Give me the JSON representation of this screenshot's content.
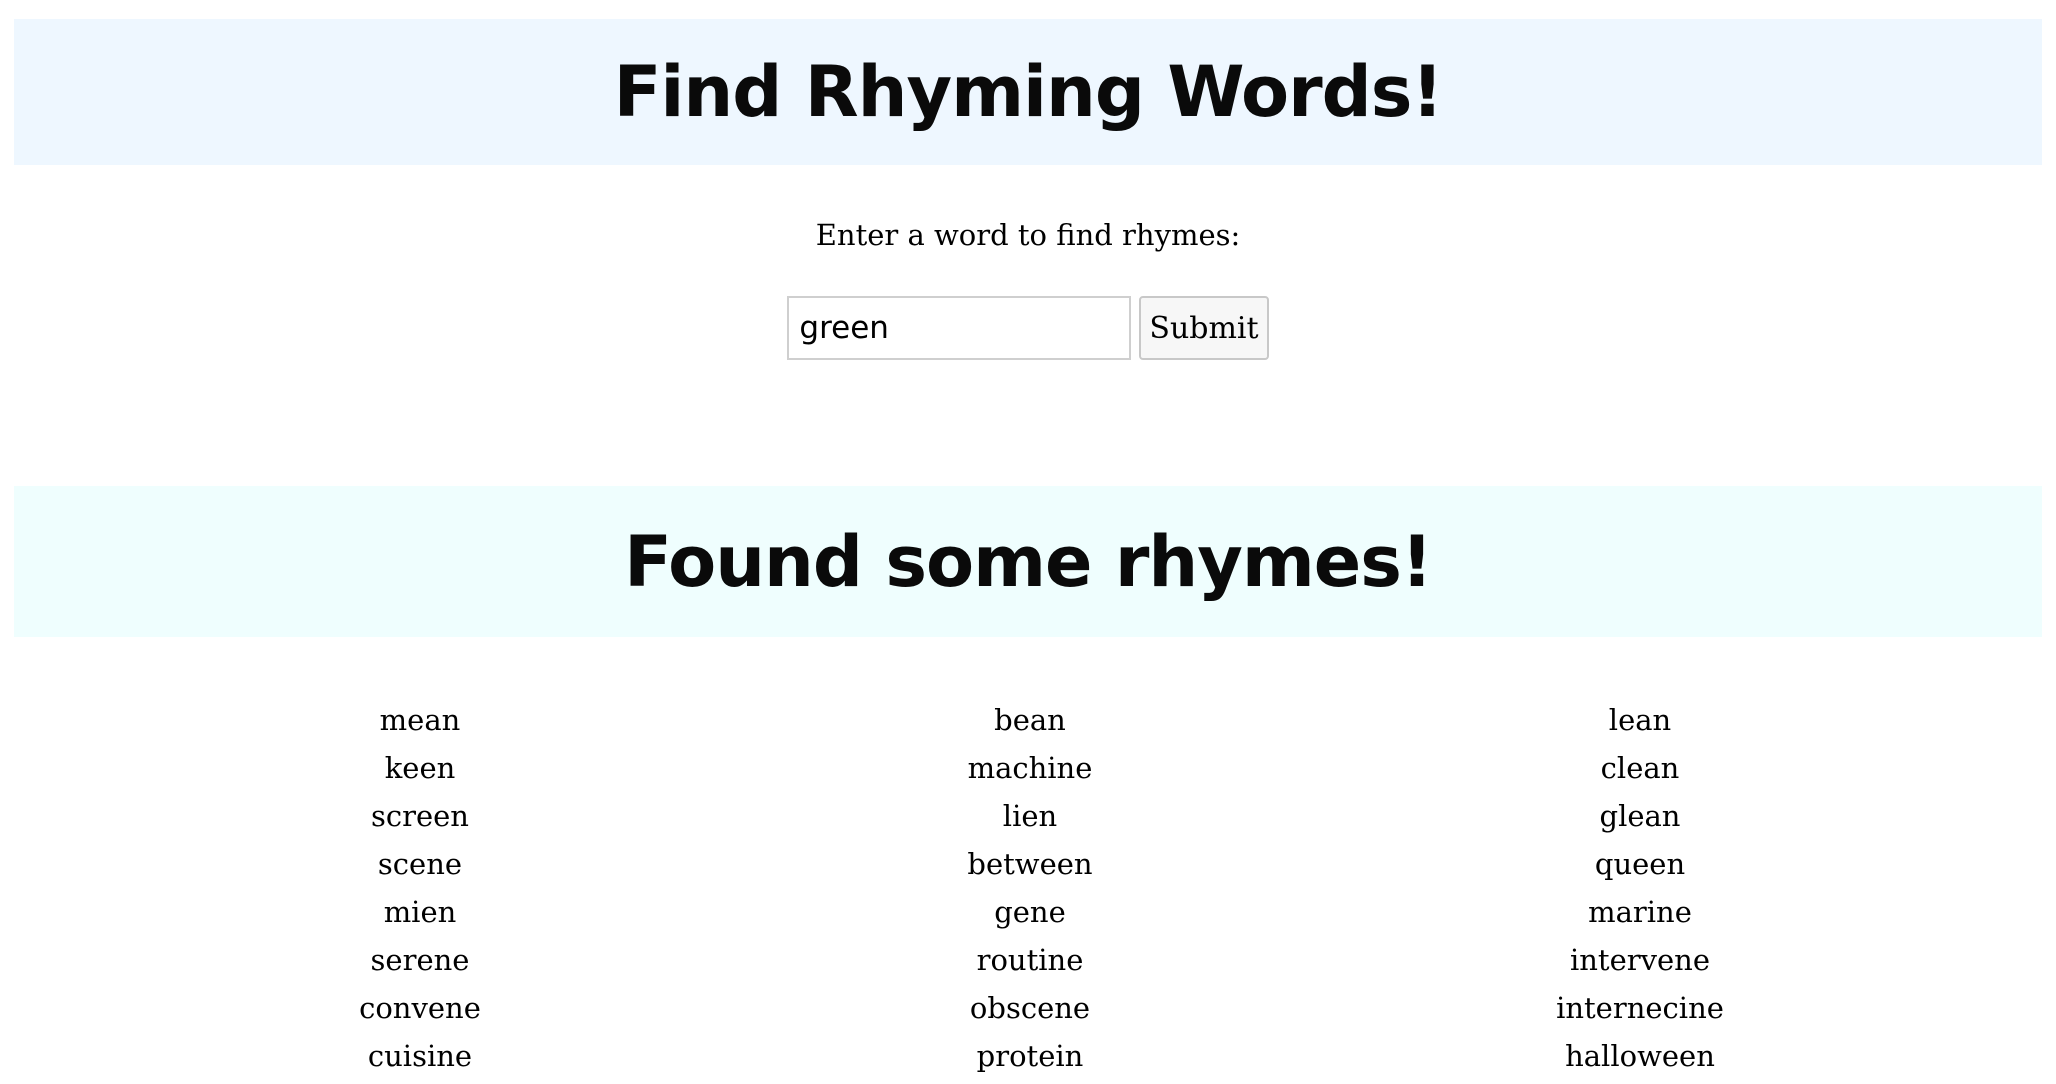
{
  "header": {
    "title": "Find Rhyming Words!"
  },
  "search": {
    "prompt": "Enter a word to find rhymes:",
    "value": "green",
    "submit_label": "Submit"
  },
  "results": {
    "title": "Found some rhymes!",
    "columns": [
      [
        "mean",
        "keen",
        "screen",
        "scene",
        "mien",
        "serene",
        "convene",
        "cuisine"
      ],
      [
        "bean",
        "machine",
        "lien",
        "between",
        "gene",
        "routine",
        "obscene",
        "protein"
      ],
      [
        "lean",
        "clean",
        "glean",
        "queen",
        "marine",
        "intervene",
        "internecine",
        "halloween"
      ]
    ]
  }
}
